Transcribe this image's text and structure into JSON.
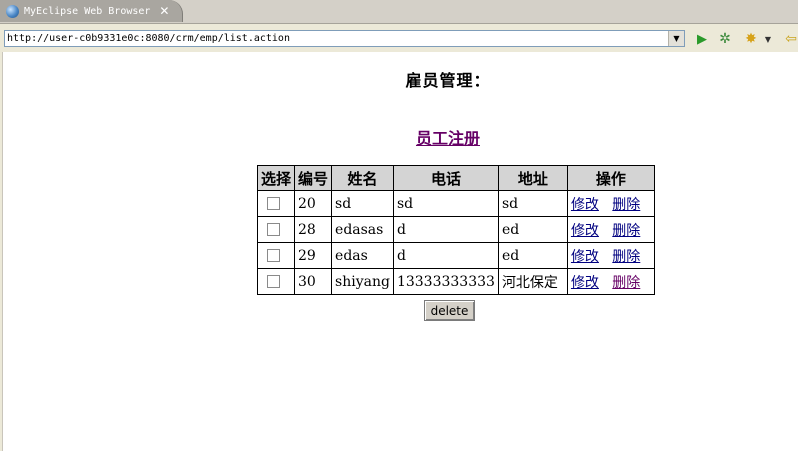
{
  "browser": {
    "tab_title": "MyEclipse Web Browser",
    "url": "http://user-c0b9331e0c:8080/crm/emp/list.action",
    "icons": {
      "tab": "globe-icon",
      "close": "close-icon",
      "go": "go-arrow-icon",
      "refresh": "refresh-icon",
      "favorites": "favorites-star-icon",
      "back": "back-arrow-icon"
    }
  },
  "page": {
    "title": "雇员管理：",
    "register_link": "员工注册",
    "table": {
      "headers": [
        "选择",
        "编号",
        "姓名",
        "电话",
        "地址",
        "操作"
      ],
      "rows": [
        {
          "id": "20",
          "name": "sd",
          "phone": "sd",
          "address": "sd",
          "edit": "修改",
          "delete": "删除"
        },
        {
          "id": "28",
          "name": "edasas",
          "phone": "d",
          "address": "ed",
          "edit": "修改",
          "delete": "删除"
        },
        {
          "id": "29",
          "name": "edas",
          "phone": "d",
          "address": "ed",
          "edit": "修改",
          "delete": "删除"
        },
        {
          "id": "30",
          "name": "shiyang",
          "phone": "13333333333",
          "address": "河北保定",
          "edit": "修改",
          "delete": "删除"
        }
      ]
    },
    "delete_button": "delete"
  }
}
